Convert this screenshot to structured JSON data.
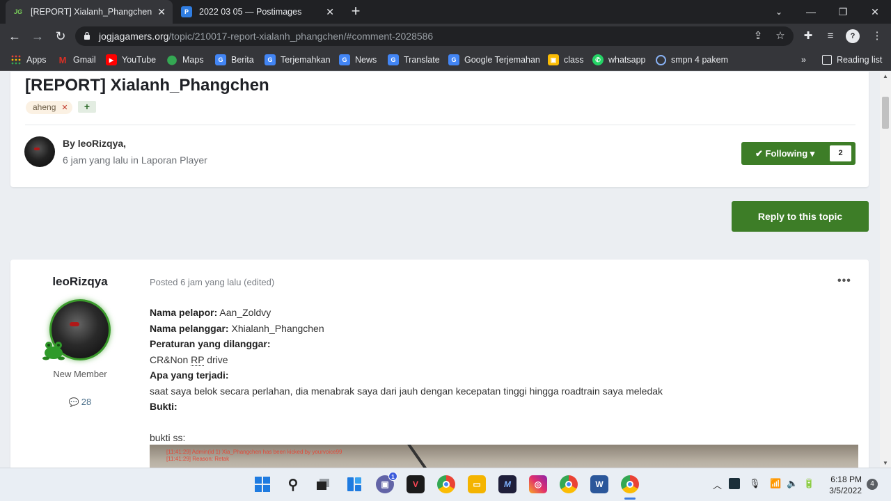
{
  "browser": {
    "tabs": [
      {
        "title": "[REPORT] Xialanh_Phangchen - L",
        "favicon": "JG"
      },
      {
        "title": "2022 03 05 — Postimages",
        "favicon": "P"
      }
    ],
    "url_host": "jogjagamers.org",
    "url_path": "/topic/210017-report-xialanh_phangchen/#comment-2028586",
    "bookmarks": [
      {
        "label": "Apps",
        "color": "#ea4335"
      },
      {
        "label": "Gmail",
        "color": "#d93025"
      },
      {
        "label": "YouTube",
        "color": "#ff0000"
      },
      {
        "label": "Maps",
        "color": "#34a853"
      },
      {
        "label": "Berita",
        "color": "#4285f4"
      },
      {
        "label": "Terjemahkan",
        "color": "#4285f4"
      },
      {
        "label": "News",
        "color": "#4285f4"
      },
      {
        "label": "Translate",
        "color": "#4285f4"
      },
      {
        "label": "Google Terjemahan",
        "color": "#4285f4"
      },
      {
        "label": "class",
        "color": "#fbbc04"
      },
      {
        "label": "whatsapp",
        "color": "#25d366"
      },
      {
        "label": "smpn 4 pakem",
        "color": "#8ab4f8"
      }
    ],
    "bookmarks_more": "»",
    "reading_list": "Reading list"
  },
  "topic": {
    "title": "[REPORT] Xialanh_Phangchen",
    "tag": "aheng",
    "tag_add": "+",
    "by_line": "By leoRizqya,",
    "meta": "6 jam yang lalu in Laporan Player",
    "follow_label": "✔ Following ▾",
    "follow_count": "2",
    "reply_label": "Reply to this topic"
  },
  "post": {
    "author": "leoRizqya",
    "rank": "New Member",
    "post_count": "28",
    "posted": "Posted 6 jam yang lalu (edited)",
    "more": "•••",
    "lines": [
      {
        "label": "Nama pelapor:",
        "text": " Aan_Zoldvy"
      },
      {
        "label": "Nama pelanggar:",
        "text": " Xhialanh_Phangchen"
      },
      {
        "label": "Peraturan yang dilanggar:",
        "text": ""
      },
      {
        "label": "",
        "text": "CR&Non ",
        "underline": "RP",
        "after": " drive"
      },
      {
        "label": "Apa yang terjadi:",
        "text": ""
      },
      {
        "label": "",
        "text": "saat saya belok secara perlahan, dia menabrak saya dari jauh dengan kecepatan tinggi hingga roadtrain saya meledak"
      },
      {
        "label": "Bukti:",
        "text": ""
      },
      {
        "label": "",
        "text": ""
      },
      {
        "label": "",
        "text": "bukti ss:"
      }
    ],
    "image_lines": [
      "[11:41:29] Admin(id 1) Xia_Phangchen has been kicked by yourvoice99",
      "[11:41:29] Reason: Retak"
    ]
  },
  "taskbar": {
    "time": "6:18 PM",
    "date": "3/5/2022",
    "notifications": "4",
    "chat_badge": "1"
  },
  "colors": {
    "accent_green": "#3d7d27",
    "tag_bg": "#fbf1e3"
  }
}
